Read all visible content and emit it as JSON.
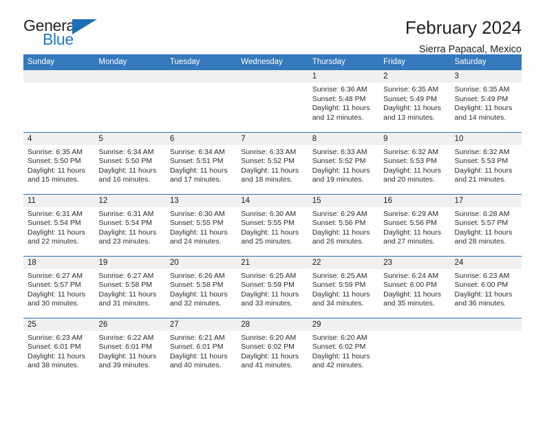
{
  "brand": {
    "name_top": "General",
    "name_bottom": "Blue",
    "accent_color": "#1b6fb5",
    "text_color": "#231f20"
  },
  "header": {
    "title": "February 2024",
    "location": "Sierra Papacal, Mexico"
  },
  "theme": {
    "header_bar_color": "#3479bb",
    "row_divider_color": "#2f72b3",
    "daynum_band_color": "#f0f0f0"
  },
  "calendar": {
    "weekday_headers": [
      "Sunday",
      "Monday",
      "Tuesday",
      "Wednesday",
      "Thursday",
      "Friday",
      "Saturday"
    ],
    "weeks": [
      [
        {
          "day": "",
          "sunrise": "",
          "sunset": "",
          "daylight1": "",
          "daylight2": ""
        },
        {
          "day": "",
          "sunrise": "",
          "sunset": "",
          "daylight1": "",
          "daylight2": ""
        },
        {
          "day": "",
          "sunrise": "",
          "sunset": "",
          "daylight1": "",
          "daylight2": ""
        },
        {
          "day": "",
          "sunrise": "",
          "sunset": "",
          "daylight1": "",
          "daylight2": ""
        },
        {
          "day": "1",
          "sunrise": "Sunrise: 6:36 AM",
          "sunset": "Sunset: 5:48 PM",
          "daylight1": "Daylight: 11 hours",
          "daylight2": "and 12 minutes."
        },
        {
          "day": "2",
          "sunrise": "Sunrise: 6:35 AM",
          "sunset": "Sunset: 5:49 PM",
          "daylight1": "Daylight: 11 hours",
          "daylight2": "and 13 minutes."
        },
        {
          "day": "3",
          "sunrise": "Sunrise: 6:35 AM",
          "sunset": "Sunset: 5:49 PM",
          "daylight1": "Daylight: 11 hours",
          "daylight2": "and 14 minutes."
        }
      ],
      [
        {
          "day": "4",
          "sunrise": "Sunrise: 6:35 AM",
          "sunset": "Sunset: 5:50 PM",
          "daylight1": "Daylight: 11 hours",
          "daylight2": "and 15 minutes."
        },
        {
          "day": "5",
          "sunrise": "Sunrise: 6:34 AM",
          "sunset": "Sunset: 5:50 PM",
          "daylight1": "Daylight: 11 hours",
          "daylight2": "and 16 minutes."
        },
        {
          "day": "6",
          "sunrise": "Sunrise: 6:34 AM",
          "sunset": "Sunset: 5:51 PM",
          "daylight1": "Daylight: 11 hours",
          "daylight2": "and 17 minutes."
        },
        {
          "day": "7",
          "sunrise": "Sunrise: 6:33 AM",
          "sunset": "Sunset: 5:52 PM",
          "daylight1": "Daylight: 11 hours",
          "daylight2": "and 18 minutes."
        },
        {
          "day": "8",
          "sunrise": "Sunrise: 6:33 AM",
          "sunset": "Sunset: 5:52 PM",
          "daylight1": "Daylight: 11 hours",
          "daylight2": "and 19 minutes."
        },
        {
          "day": "9",
          "sunrise": "Sunrise: 6:32 AM",
          "sunset": "Sunset: 5:53 PM",
          "daylight1": "Daylight: 11 hours",
          "daylight2": "and 20 minutes."
        },
        {
          "day": "10",
          "sunrise": "Sunrise: 6:32 AM",
          "sunset": "Sunset: 5:53 PM",
          "daylight1": "Daylight: 11 hours",
          "daylight2": "and 21 minutes."
        }
      ],
      [
        {
          "day": "11",
          "sunrise": "Sunrise: 6:31 AM",
          "sunset": "Sunset: 5:54 PM",
          "daylight1": "Daylight: 11 hours",
          "daylight2": "and 22 minutes."
        },
        {
          "day": "12",
          "sunrise": "Sunrise: 6:31 AM",
          "sunset": "Sunset: 5:54 PM",
          "daylight1": "Daylight: 11 hours",
          "daylight2": "and 23 minutes."
        },
        {
          "day": "13",
          "sunrise": "Sunrise: 6:30 AM",
          "sunset": "Sunset: 5:55 PM",
          "daylight1": "Daylight: 11 hours",
          "daylight2": "and 24 minutes."
        },
        {
          "day": "14",
          "sunrise": "Sunrise: 6:30 AM",
          "sunset": "Sunset: 5:55 PM",
          "daylight1": "Daylight: 11 hours",
          "daylight2": "and 25 minutes."
        },
        {
          "day": "15",
          "sunrise": "Sunrise: 6:29 AM",
          "sunset": "Sunset: 5:56 PM",
          "daylight1": "Daylight: 11 hours",
          "daylight2": "and 26 minutes."
        },
        {
          "day": "16",
          "sunrise": "Sunrise: 6:29 AM",
          "sunset": "Sunset: 5:56 PM",
          "daylight1": "Daylight: 11 hours",
          "daylight2": "and 27 minutes."
        },
        {
          "day": "17",
          "sunrise": "Sunrise: 6:28 AM",
          "sunset": "Sunset: 5:57 PM",
          "daylight1": "Daylight: 11 hours",
          "daylight2": "and 28 minutes."
        }
      ],
      [
        {
          "day": "18",
          "sunrise": "Sunrise: 6:27 AM",
          "sunset": "Sunset: 5:57 PM",
          "daylight1": "Daylight: 11 hours",
          "daylight2": "and 30 minutes."
        },
        {
          "day": "19",
          "sunrise": "Sunrise: 6:27 AM",
          "sunset": "Sunset: 5:58 PM",
          "daylight1": "Daylight: 11 hours",
          "daylight2": "and 31 minutes."
        },
        {
          "day": "20",
          "sunrise": "Sunrise: 6:26 AM",
          "sunset": "Sunset: 5:58 PM",
          "daylight1": "Daylight: 11 hours",
          "daylight2": "and 32 minutes."
        },
        {
          "day": "21",
          "sunrise": "Sunrise: 6:25 AM",
          "sunset": "Sunset: 5:59 PM",
          "daylight1": "Daylight: 11 hours",
          "daylight2": "and 33 minutes."
        },
        {
          "day": "22",
          "sunrise": "Sunrise: 6:25 AM",
          "sunset": "Sunset: 5:59 PM",
          "daylight1": "Daylight: 11 hours",
          "daylight2": "and 34 minutes."
        },
        {
          "day": "23",
          "sunrise": "Sunrise: 6:24 AM",
          "sunset": "Sunset: 6:00 PM",
          "daylight1": "Daylight: 11 hours",
          "daylight2": "and 35 minutes."
        },
        {
          "day": "24",
          "sunrise": "Sunrise: 6:23 AM",
          "sunset": "Sunset: 6:00 PM",
          "daylight1": "Daylight: 11 hours",
          "daylight2": "and 36 minutes."
        }
      ],
      [
        {
          "day": "25",
          "sunrise": "Sunrise: 6:23 AM",
          "sunset": "Sunset: 6:01 PM",
          "daylight1": "Daylight: 11 hours",
          "daylight2": "and 38 minutes."
        },
        {
          "day": "26",
          "sunrise": "Sunrise: 6:22 AM",
          "sunset": "Sunset: 6:01 PM",
          "daylight1": "Daylight: 11 hours",
          "daylight2": "and 39 minutes."
        },
        {
          "day": "27",
          "sunrise": "Sunrise: 6:21 AM",
          "sunset": "Sunset: 6:01 PM",
          "daylight1": "Daylight: 11 hours",
          "daylight2": "and 40 minutes."
        },
        {
          "day": "28",
          "sunrise": "Sunrise: 6:20 AM",
          "sunset": "Sunset: 6:02 PM",
          "daylight1": "Daylight: 11 hours",
          "daylight2": "and 41 minutes."
        },
        {
          "day": "29",
          "sunrise": "Sunrise: 6:20 AM",
          "sunset": "Sunset: 6:02 PM",
          "daylight1": "Daylight: 11 hours",
          "daylight2": "and 42 minutes."
        },
        {
          "day": "",
          "sunrise": "",
          "sunset": "",
          "daylight1": "",
          "daylight2": ""
        },
        {
          "day": "",
          "sunrise": "",
          "sunset": "",
          "daylight1": "",
          "daylight2": ""
        }
      ]
    ]
  }
}
